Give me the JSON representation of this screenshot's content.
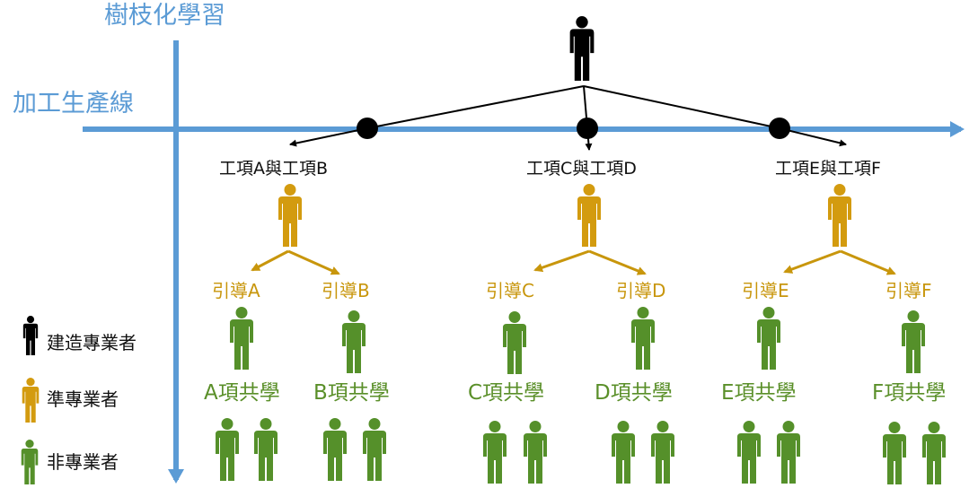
{
  "axes": {
    "vertical_label": "樹枝化學習",
    "horizontal_label": "加工生產線"
  },
  "tasks": [
    {
      "label": "工項A與工項B"
    },
    {
      "label": "工項C與工項D"
    },
    {
      "label": "工項E與工項F"
    }
  ],
  "guides": [
    "引導A",
    "引導B",
    "引導C",
    "引導D",
    "引導E",
    "引導F"
  ],
  "groups": [
    "A項共學",
    "B項共學",
    "C項共學",
    "D項共學",
    "E項共學",
    "F項共學"
  ],
  "legend": [
    {
      "label": "建造專業者",
      "color": "#000000",
      "icon": "person-icon"
    },
    {
      "label": "準專業者",
      "color": "#d39b0f",
      "icon": "person-icon"
    },
    {
      "label": "非專業者",
      "color": "#55902a",
      "icon": "person-icon"
    }
  ],
  "colors": {
    "axis": "#5b9bd5",
    "expert": "#000000",
    "semi_expert": "#d39b0f",
    "non_expert": "#55902a",
    "guide_text": "#c8960c",
    "group_text": "#5a8f29"
  }
}
